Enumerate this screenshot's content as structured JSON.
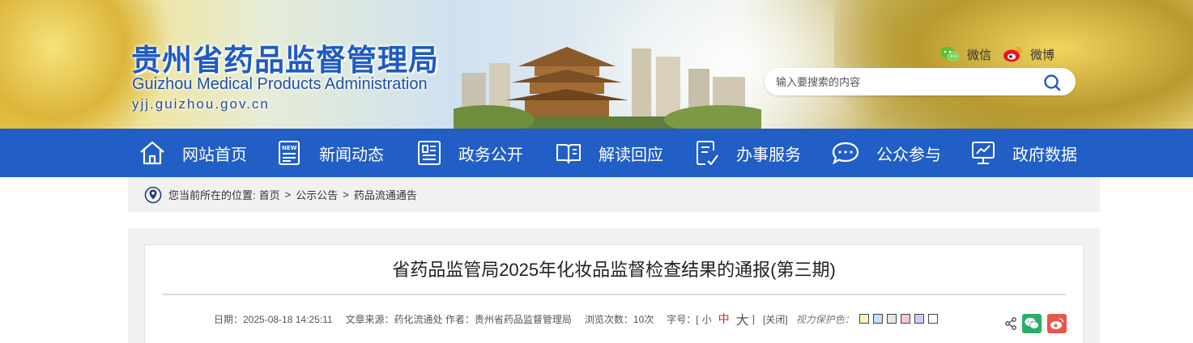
{
  "header": {
    "title_cn": "贵州省药品监督管理局",
    "title_en": "Guizhou Medical Products Administration",
    "url": "yjj.guizhou.gov.cn",
    "wechat_label": "微信",
    "weibo_label": "微博",
    "search_placeholder": "输入要搜索的内容",
    "search_icon": "search-icon"
  },
  "nav": {
    "items": [
      {
        "label": "网站首页",
        "icon": "home-icon"
      },
      {
        "label": "新闻动态",
        "icon": "news-icon"
      },
      {
        "label": "政务公开",
        "icon": "document-icon"
      },
      {
        "label": "解读回应",
        "icon": "open-book-icon"
      },
      {
        "label": "办事服务",
        "icon": "service-form-icon"
      },
      {
        "label": "公众参与",
        "icon": "chat-bubble-icon"
      },
      {
        "label": "政府数据",
        "icon": "data-monitor-icon"
      }
    ]
  },
  "breadcrumb": {
    "prefix": "您当前所在的位置:",
    "items": [
      "首页",
      "公示公告",
      "药品流通通告"
    ],
    "separator": ">"
  },
  "article": {
    "title": "省药品监管局2025年化妆品监督检查结果的通报(第三期)",
    "date": "日期：2025-08-18 14:25:11",
    "source": "文章来源：药化流通处 作者：贵州省药品监督管理局",
    "views": "浏览次数：10次",
    "font_size_label": "字号：[",
    "font_small": "小",
    "font_mid": "中",
    "font_big": "大",
    "font_close_bracket": "]",
    "close": "[关闭]",
    "vision_label": "视力保护色：",
    "vision_colors": [
      "#faf4b8",
      "#bfe3f2",
      "#e6e6e6",
      "#f4c7d8",
      "#d9c7f2",
      "#ffffff"
    ],
    "accent_color": "#d8261d"
  },
  "theme": {
    "nav_bg": "#215ec6",
    "title_blue": "#1f5bc4"
  }
}
